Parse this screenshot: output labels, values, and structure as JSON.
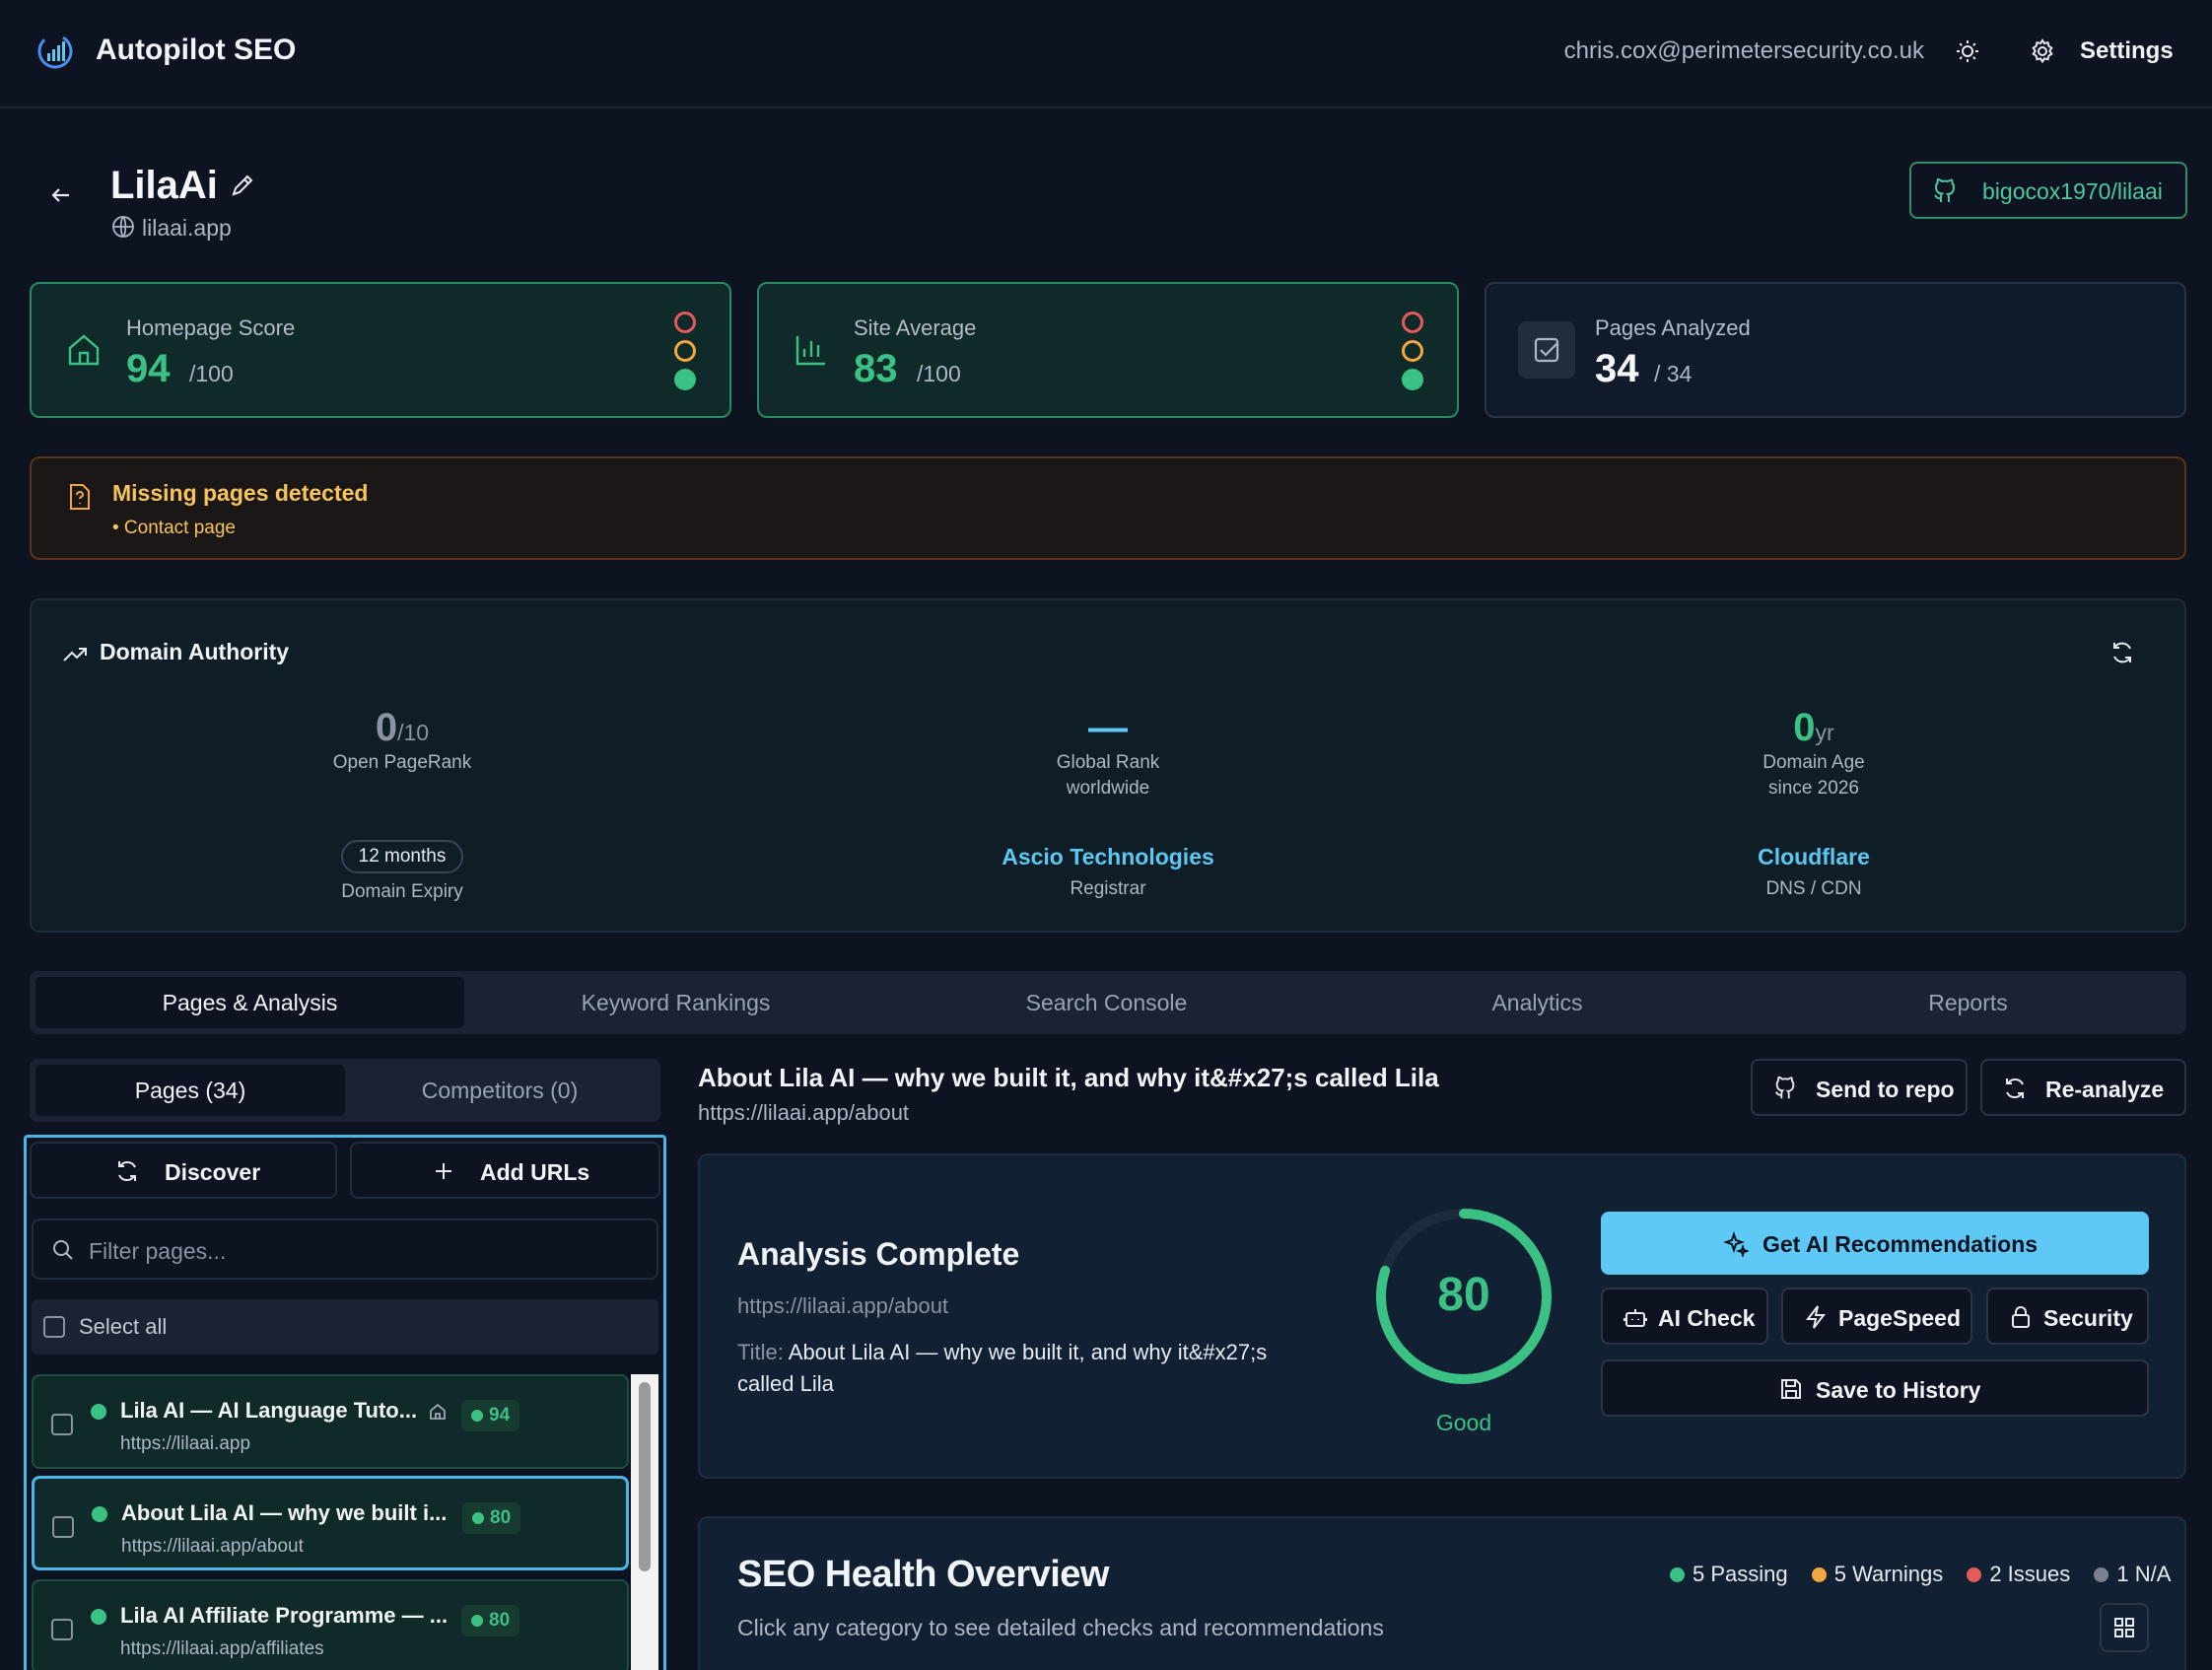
{
  "app": {
    "name": "Autopilot SEO",
    "user_email": "chris.cox@perimetersecurity.co.uk",
    "settings_label": "Settings"
  },
  "project": {
    "name": "LilaAi",
    "domain": "lilaai.app",
    "repo": "bigocox1970/lilaai"
  },
  "cards": {
    "homepage": {
      "label": "Homepage Score",
      "value": "94",
      "max": "/100"
    },
    "site": {
      "label": "Site Average",
      "value": "83",
      "max": "/100"
    },
    "pages": {
      "label": "Pages Analyzed",
      "value": "34",
      "max": "/ 34"
    }
  },
  "alert": {
    "title": "Missing pages detected",
    "item": "• Contact page"
  },
  "domain_authority": {
    "title": "Domain Authority",
    "pagerank": {
      "value": "0",
      "unit": "/10",
      "label": "Open PageRank"
    },
    "global_rank": {
      "value": "—",
      "label": "Global Rank",
      "sub": "worldwide"
    },
    "domain_age": {
      "value": "0",
      "unit": "yr",
      "label": "Domain Age",
      "sub": "since 2026"
    },
    "expiry": {
      "value": "12 months",
      "label": "Domain Expiry"
    },
    "registrar": {
      "value": "Ascio Technologies",
      "label": "Registrar"
    },
    "dns": {
      "value": "Cloudflare",
      "label": "DNS / CDN"
    }
  },
  "tabs": [
    "Pages & Analysis",
    "Keyword Rankings",
    "Search Console",
    "Analytics",
    "Reports"
  ],
  "left": {
    "subtabs": [
      "Pages (34)",
      "Competitors (0)"
    ],
    "discover_label": "Discover",
    "add_urls_label": "Add URLs",
    "filter_placeholder": "Filter pages...",
    "select_all": "Select all",
    "pages": [
      {
        "title": "Lila AI — AI Language Tuto...",
        "url": "https://lilaai.app",
        "score": "94"
      },
      {
        "title": "About Lila AI — why we built i...",
        "url": "https://lilaai.app/about",
        "score": "80"
      },
      {
        "title": "Lila AI Affiliate Programme — ...",
        "url": "https://lilaai.app/affiliates",
        "score": "80"
      }
    ]
  },
  "detail": {
    "title": "About Lila AI — why we built it, and why it&#x27;s called Lila",
    "url": "https://lilaai.app/about",
    "send_label": "Send to repo",
    "reanalyze_label": "Re-analyze",
    "analysis": {
      "heading": "Analysis Complete",
      "url": "https://lilaai.app/about",
      "title_label": "Title: ",
      "title_value": "About Lila AI — why we built it, and why it&#x27;s called Lila",
      "score": 80,
      "score_text": "80",
      "rating": "Good",
      "ai_rec_label": "Get AI Recommendations",
      "ai_check_label": "AI Check",
      "pagespeed_label": "PageSpeed",
      "security_label": "Security",
      "save_label": "Save to History"
    },
    "health": {
      "heading": "SEO Health Overview",
      "sub": "Click any category to see detailed checks and recommendations",
      "passing": "5 Passing",
      "warnings": "5 Warnings",
      "issues": "2 Issues",
      "na": "1 N/A"
    }
  },
  "colors": {
    "accent": "#5ec9f5",
    "good": "#3cc185",
    "warn": "#f0a940",
    "bad": "#e45b5b",
    "na": "#7a8292"
  }
}
